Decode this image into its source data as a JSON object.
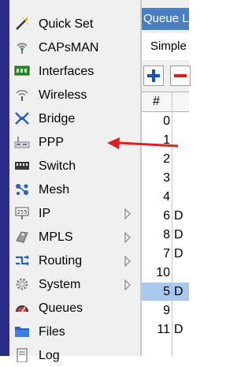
{
  "menu": {
    "items": [
      {
        "label": "Quick Set",
        "icon": "wand-icon"
      },
      {
        "label": "CAPsMAN",
        "icon": "antenna-icon"
      },
      {
        "label": "Interfaces",
        "icon": "interfaces-icon"
      },
      {
        "label": "Wireless",
        "icon": "wireless-icon"
      },
      {
        "label": "Bridge",
        "icon": "bridge-icon"
      },
      {
        "label": "PPP",
        "icon": "ppp-icon"
      },
      {
        "label": "Switch",
        "icon": "switch-icon"
      },
      {
        "label": "Mesh",
        "icon": "mesh-icon"
      },
      {
        "label": "IP",
        "icon": "ip-icon"
      },
      {
        "label": "MPLS",
        "icon": "mpls-icon"
      },
      {
        "label": "Routing",
        "icon": "routing-icon"
      },
      {
        "label": "System",
        "icon": "gear-icon"
      },
      {
        "label": "Queues",
        "icon": "queues-icon"
      },
      {
        "label": "Files",
        "icon": "folder-icon"
      },
      {
        "label": "Log",
        "icon": "log-icon"
      }
    ]
  },
  "panel": {
    "title": "Queue L",
    "tab": "Simple",
    "table": {
      "header": "#",
      "rows": [
        {
          "num": "0",
          "flag": ""
        },
        {
          "num": "1",
          "flag": ""
        },
        {
          "num": "2",
          "flag": ""
        },
        {
          "num": "3",
          "flag": ""
        },
        {
          "num": "4",
          "flag": ""
        },
        {
          "num": "6",
          "flag": "D"
        },
        {
          "num": "8",
          "flag": "D"
        },
        {
          "num": "7",
          "flag": "D"
        },
        {
          "num": "10",
          "flag": ""
        },
        {
          "num": "5",
          "flag": "D"
        },
        {
          "num": "9",
          "flag": ""
        },
        {
          "num": "11",
          "flag": "D"
        }
      ],
      "selected_row": "5"
    }
  },
  "annotation": {
    "color": "#e02020",
    "target": "PPP"
  },
  "colors": {
    "accent": "#2c2c8c",
    "title_bar": "#4a7fbf",
    "selection": "#a9c8ef"
  }
}
